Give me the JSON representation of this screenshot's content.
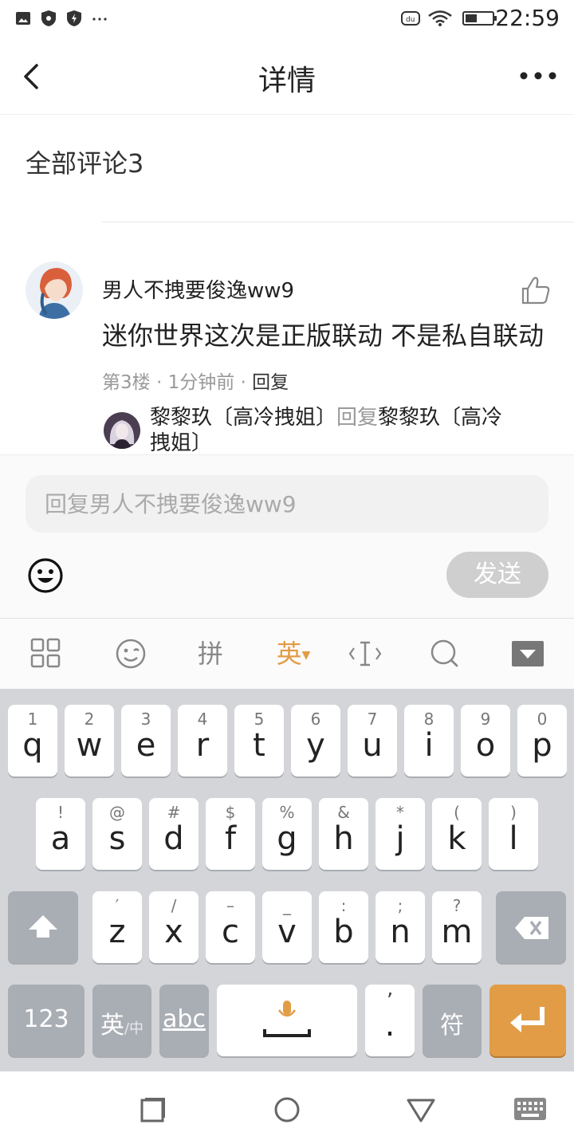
{
  "status_bar": {
    "time": "22:59",
    "icons": [
      "image-icon",
      "eye-shield-icon",
      "shield-bolt-icon",
      "more-dots-icon",
      "du-icon",
      "wifi-icon",
      "battery-icon"
    ]
  },
  "header": {
    "title": "详情",
    "back_icon": "chevron-left-icon",
    "more_icon": "more-horizontal-icon"
  },
  "comments_section": {
    "title": "全部评论3"
  },
  "comment": {
    "author": "男人不拽要俊逸ww9",
    "body": "迷你世界这次是正版联动 不是私自联动",
    "floor": "第3楼",
    "sep1": "·",
    "time": "1分钟前",
    "sep2": "·",
    "reply_label": "回复",
    "sub_reply": {
      "author": "黎黎玖〔高冷拽姐〕",
      "reply_word": "回复",
      "target_line1": "黎黎玖〔高冷",
      "target_line2": "拽姐〕"
    }
  },
  "reply_box": {
    "placeholder": "回复男人不拽要俊逸ww9",
    "send_label": "发送"
  },
  "keyboard_toolbar": {
    "pinyin_label": "拼",
    "english_label": "英"
  },
  "keyboard": {
    "row1": [
      {
        "hint": "1",
        "key": "q"
      },
      {
        "hint": "2",
        "key": "w"
      },
      {
        "hint": "3",
        "key": "e"
      },
      {
        "hint": "4",
        "key": "r"
      },
      {
        "hint": "5",
        "key": "t"
      },
      {
        "hint": "6",
        "key": "y"
      },
      {
        "hint": "7",
        "key": "u"
      },
      {
        "hint": "8",
        "key": "i"
      },
      {
        "hint": "9",
        "key": "o"
      },
      {
        "hint": "0",
        "key": "p"
      }
    ],
    "row2": [
      {
        "hint": "!",
        "key": "a"
      },
      {
        "hint": "@",
        "key": "s"
      },
      {
        "hint": "#",
        "key": "d"
      },
      {
        "hint": "$",
        "key": "f"
      },
      {
        "hint": "%",
        "key": "g"
      },
      {
        "hint": "&",
        "key": "h"
      },
      {
        "hint": "*",
        "key": "j"
      },
      {
        "hint": "(",
        "key": "k"
      },
      {
        "hint": ")",
        "key": "l"
      }
    ],
    "row3": [
      {
        "hint": "′",
        "key": "z"
      },
      {
        "hint": "/",
        "key": "x"
      },
      {
        "hint": "–",
        "key": "c"
      },
      {
        "hint": "_",
        "key": "v"
      },
      {
        "hint": ":",
        "key": "b"
      },
      {
        "hint": ";",
        "key": "n"
      },
      {
        "hint": "?",
        "key": "m"
      }
    ],
    "num_label": "123",
    "lang_main": "英",
    "lang_sub": "中",
    "abc_label": "abc",
    "comma_hint": "’",
    "period_label": ".",
    "symbol_label": "符"
  },
  "colors": {
    "accent": "#e29c46",
    "send_disabled": "#cfcfcf",
    "keyboard_bg": "#d3d5d9"
  }
}
